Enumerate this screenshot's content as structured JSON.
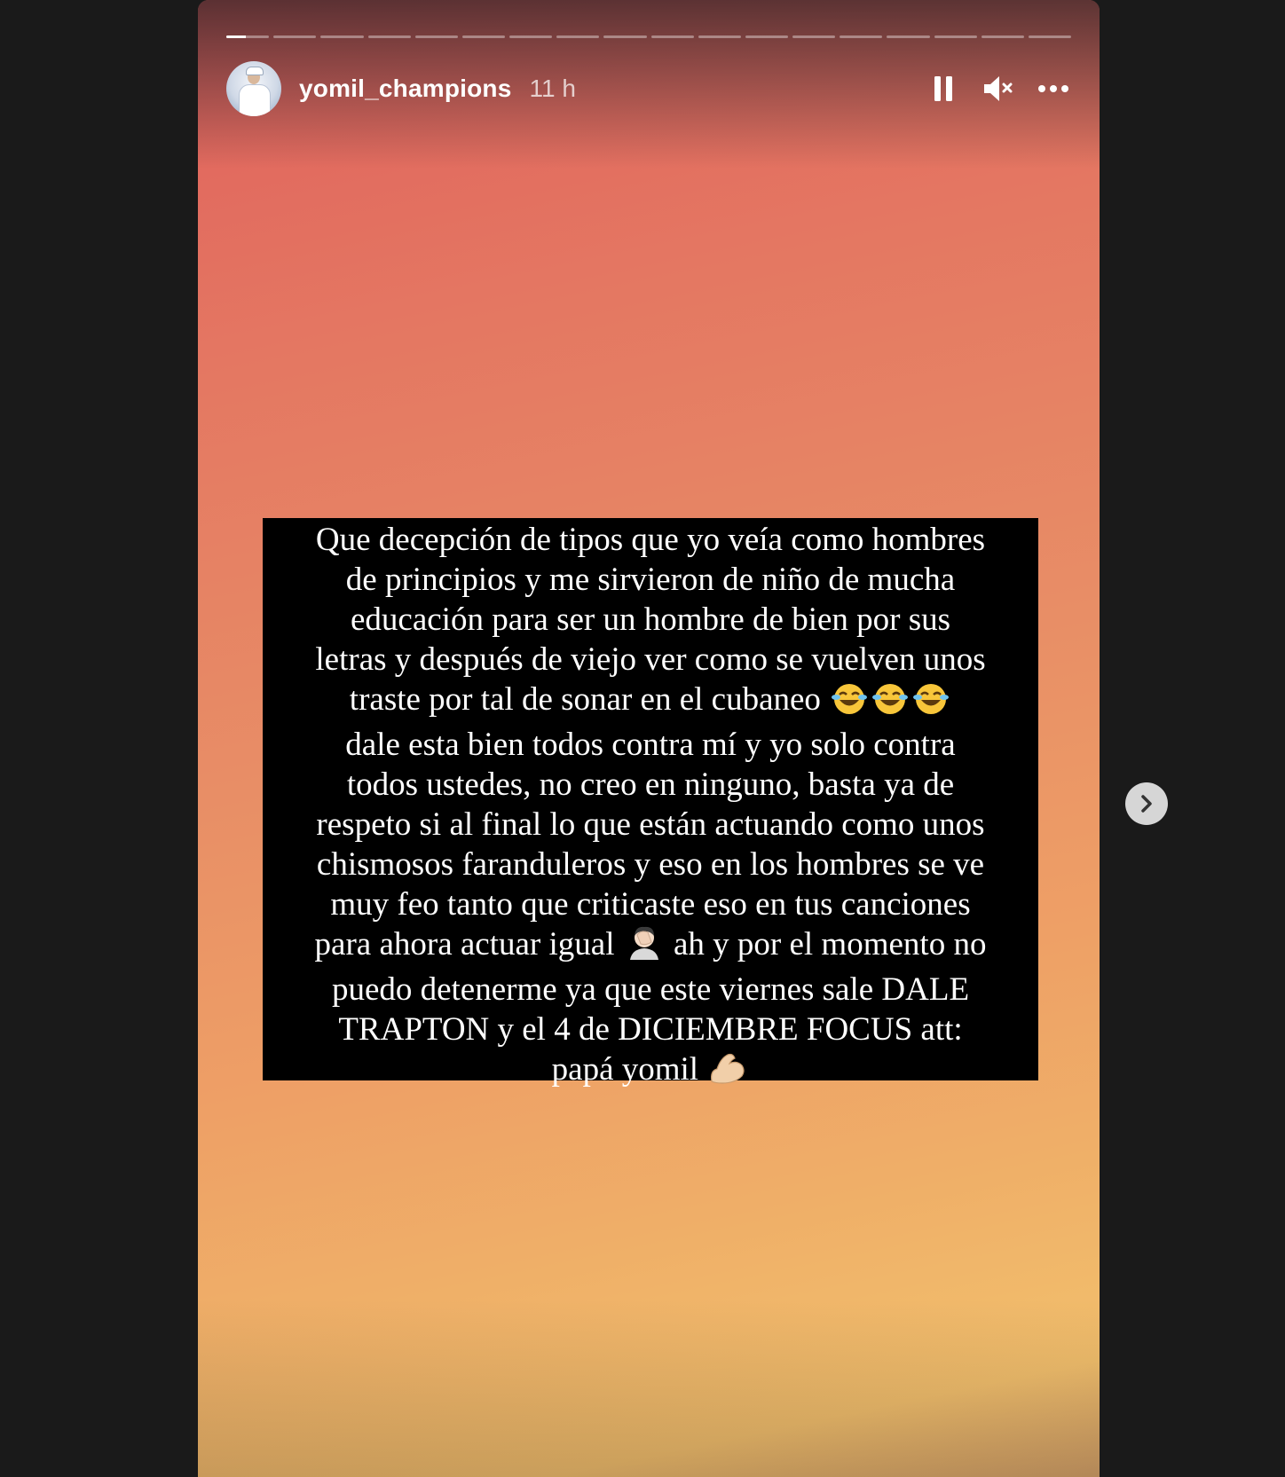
{
  "story": {
    "segment_count": 18,
    "active_segment_index": 0,
    "active_segment_progress": 0.45,
    "background_colors": [
      "#e0605c",
      "#e88e66",
      "#f2bf6c"
    ]
  },
  "header": {
    "username": "yomil_champions",
    "time": "11 h",
    "pause_icon": "pause-icon",
    "mute_icon": "muted-speaker-icon",
    "more_icon": "more-options-icon"
  },
  "post": {
    "lines": [
      "Que decepción de tipos que yo veía como hombres",
      "de principios y me sirvieron de niño de mucha",
      "educación para ser un hombre de bien por sus",
      "letras y después de viejo ver como se vuelven unos",
      "traste por tal de sonar en el cubaneo",
      "dale esta bien todos contra mí y yo solo contra",
      "todos ustedes, no creo en ninguno, basta ya de",
      "respeto si al final lo que están actuando como unos",
      "chismosos faranduleros y eso en los hombres se ve",
      "muy feo tanto que criticaste eso en tus canciones",
      "para ahora actuar igual",
      "ah y por el momento no",
      "puedo detenerme ya que este viernes sale DALE",
      "TRAPTON y el 4 de DICIEMBRE FOCUS att:",
      "papá yomil"
    ],
    "emojis": {
      "laughing": "face-with-tears-of-joy-emoji",
      "facepalm": "person-facepalming-emoji",
      "flexed_biceps": "flexed-biceps-emoji"
    }
  },
  "navigation": {
    "next_icon": "chevron-right-icon"
  }
}
